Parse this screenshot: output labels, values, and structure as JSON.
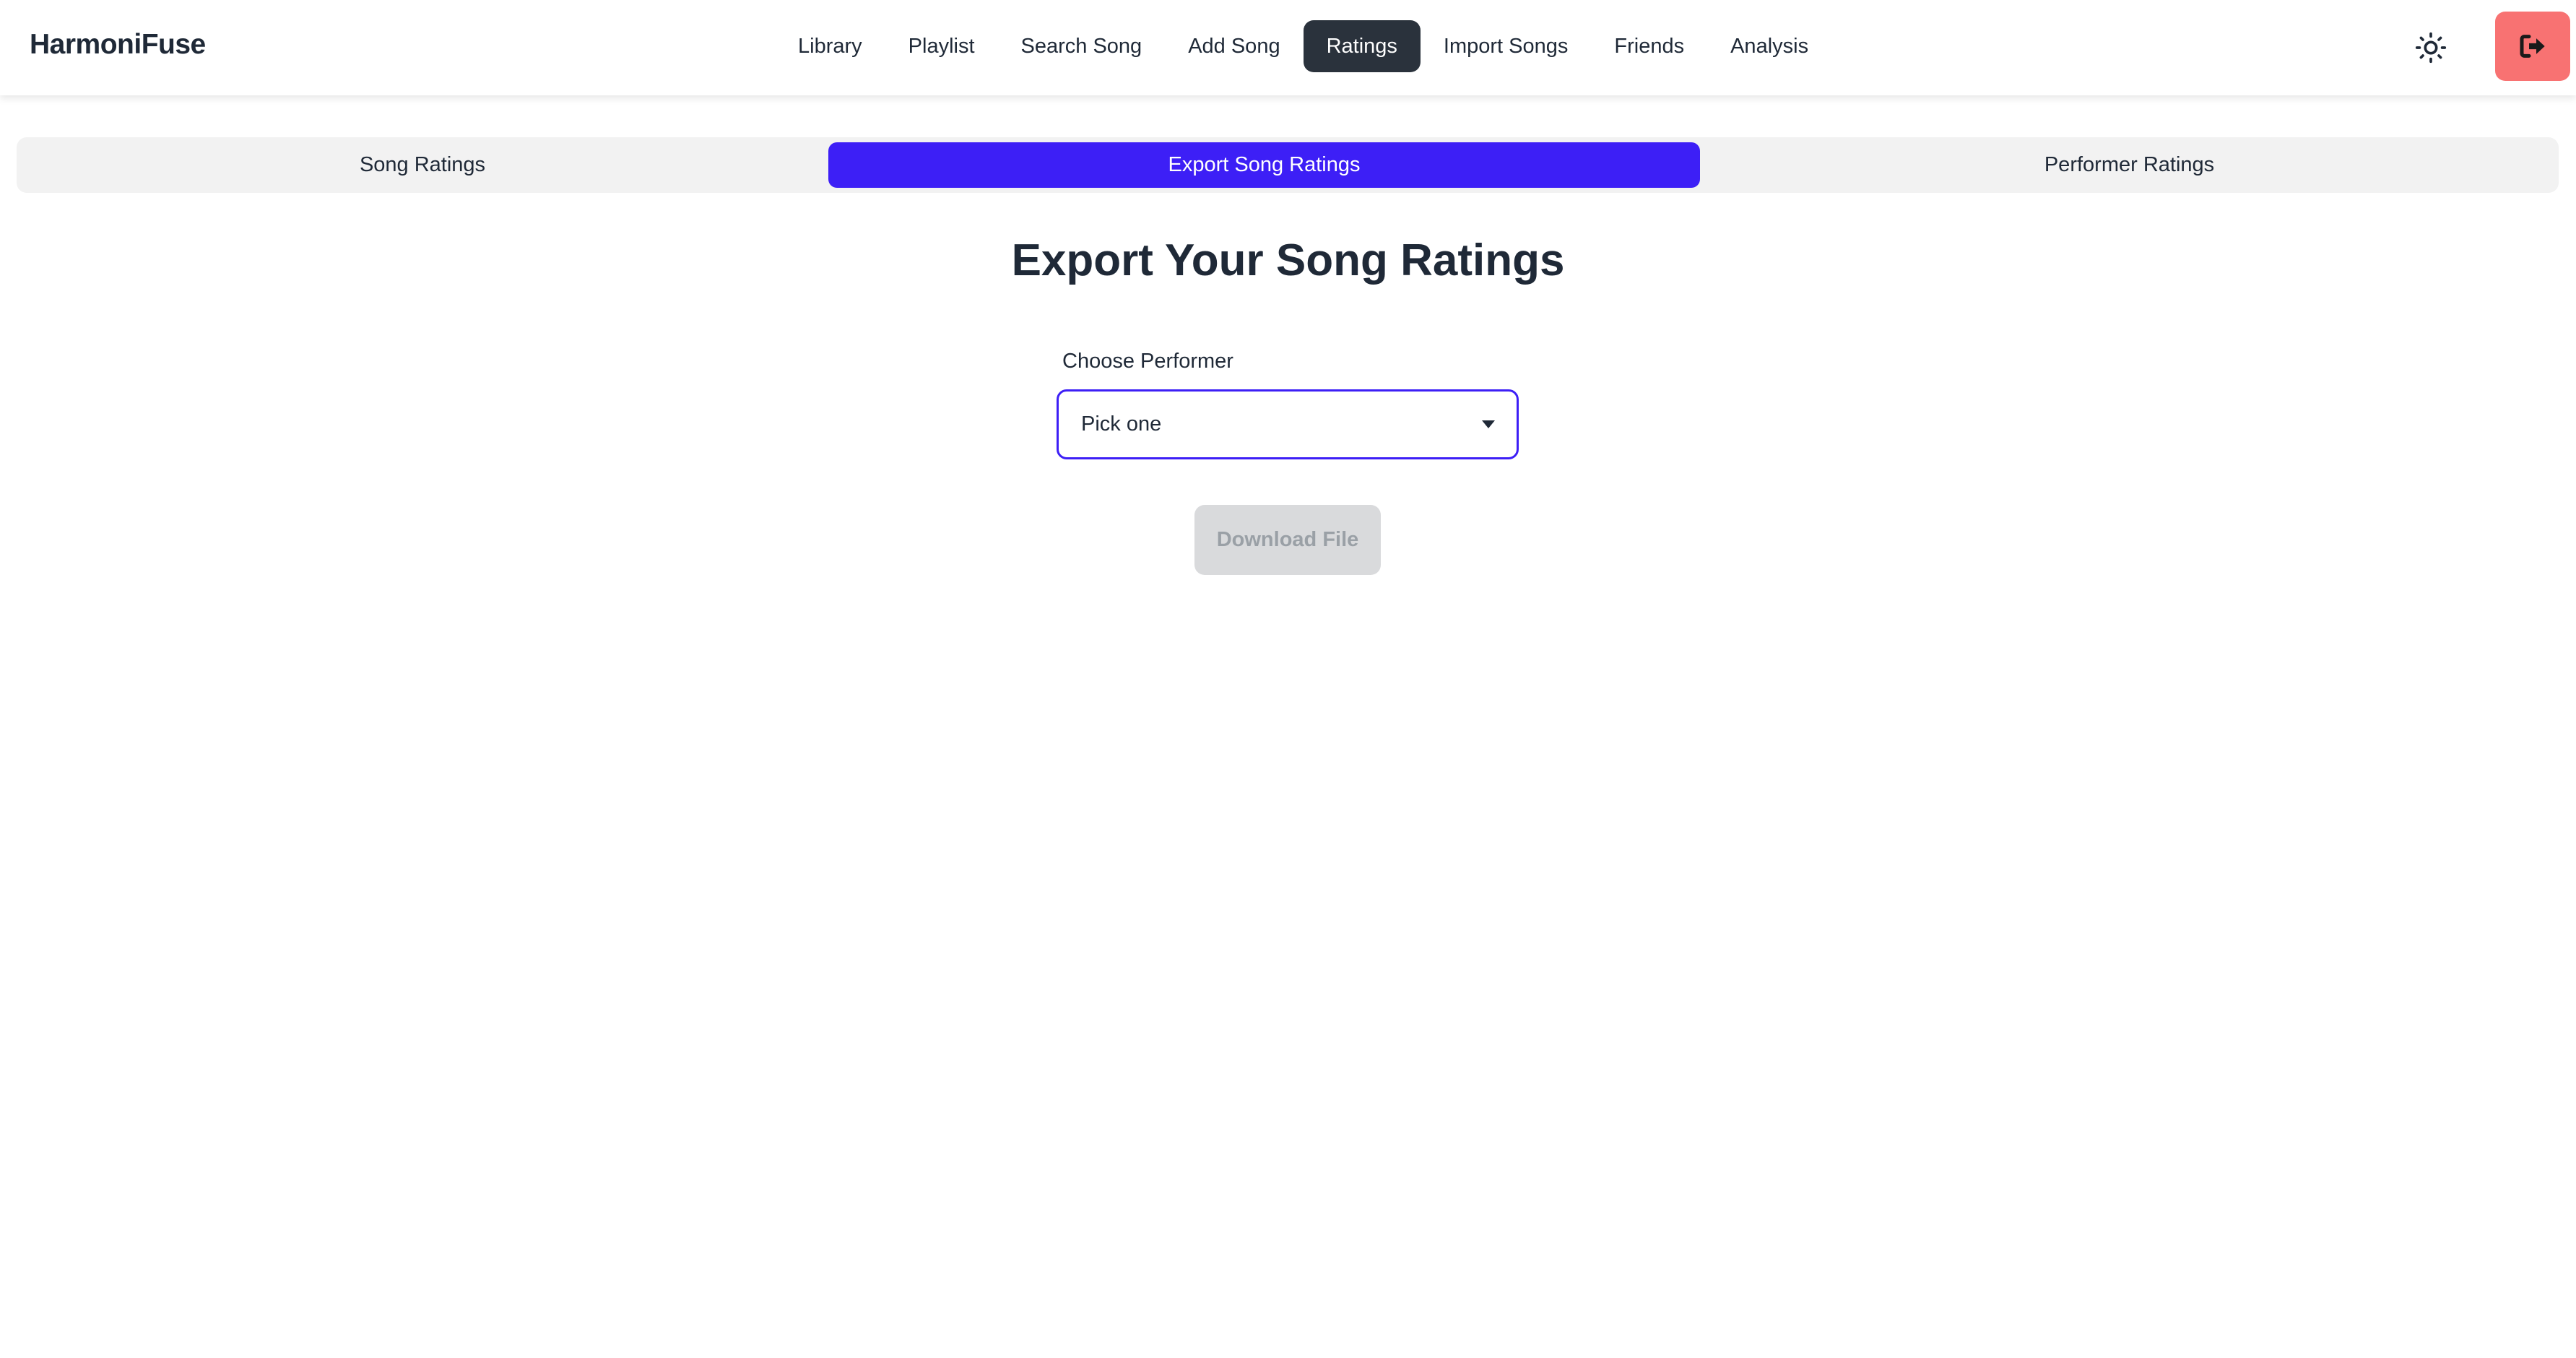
{
  "app": {
    "brand": "HarmoniFuse"
  },
  "nav": {
    "items": [
      {
        "label": "Library",
        "active": false
      },
      {
        "label": "Playlist",
        "active": false
      },
      {
        "label": "Search Song",
        "active": false
      },
      {
        "label": "Add Song",
        "active": false
      },
      {
        "label": "Ratings",
        "active": true
      },
      {
        "label": "Import Songs",
        "active": false
      },
      {
        "label": "Friends",
        "active": false
      },
      {
        "label": "Analysis",
        "active": false
      }
    ],
    "theme_icon": "sun-icon",
    "logout_icon": "logout-icon"
  },
  "tabs": [
    {
      "label": "Song Ratings",
      "active": false
    },
    {
      "label": "Export Song Ratings",
      "active": true
    },
    {
      "label": "Performer Ratings",
      "active": false
    }
  ],
  "main": {
    "title": "Export Your Song Ratings",
    "performer_label": "Choose Performer",
    "performer_select_value": "Pick one",
    "download_label": "Download File",
    "download_disabled": true
  },
  "colors": {
    "primary": "#3d1ff6",
    "active_nav": "#2a323c",
    "logout": "#f87272",
    "tab_bar": "#f2f2f2",
    "disabled_button": "#d9dadc"
  }
}
